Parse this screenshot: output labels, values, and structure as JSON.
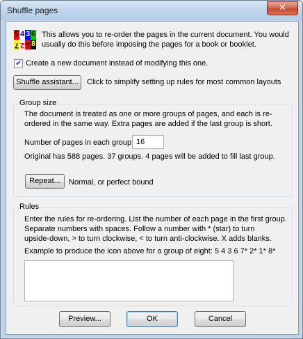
{
  "window": {
    "title": "Shuffle pages",
    "close_glyph": "✕"
  },
  "intro": {
    "icon_digits_top": [
      "5",
      "4",
      "3",
      "6"
    ],
    "icon_digits_bottom": [
      "7",
      "2",
      "1",
      "8"
    ],
    "line1": "This allows you to re-order the pages in the current document. You would",
    "line2": "usually do this before imposing the pages for a book or booklet."
  },
  "create_new": {
    "checked": true,
    "check_glyph": "✔",
    "label": "Create a new document instead of modifying this one."
  },
  "assistant": {
    "button_label": "Shuffle assistant...",
    "description": "Click to simplify setting up rules for most common layouts"
  },
  "group_size": {
    "title": "Group size",
    "desc1": "The document is treated as one or more groups of pages, and each is re-",
    "desc2": "ordered in the same way. Extra pages are added if the last group is short.",
    "pages_label": "Number of pages in each group:",
    "pages_value": "16",
    "summary": "Original has 588 pages. 37 groups. 4 pages will be added to fill last group.",
    "repeat_button": "Repeat...",
    "repeat_desc": "Normal, or perfect bound"
  },
  "rules": {
    "title": "Rules",
    "desc1": "Enter the rules for re-ordering. List the number of each page in the first group.",
    "desc2": "Separate numbers with spaces. Follow a number with * (star) to turn",
    "desc3": "upside-down, > to turn clockwise, < to turn anti-clockwise. X adds blanks.",
    "example": "Example to produce the icon above for a group of eight: 5 4 3 6 7* 2* 1* 8*",
    "value": ""
  },
  "buttons": {
    "preview": "Preview...",
    "ok": "OK",
    "cancel": "Cancel"
  },
  "colors": {
    "icon_cells": [
      "#ff0000",
      "#0000ff",
      "#00cc00",
      "#ffff00"
    ]
  }
}
